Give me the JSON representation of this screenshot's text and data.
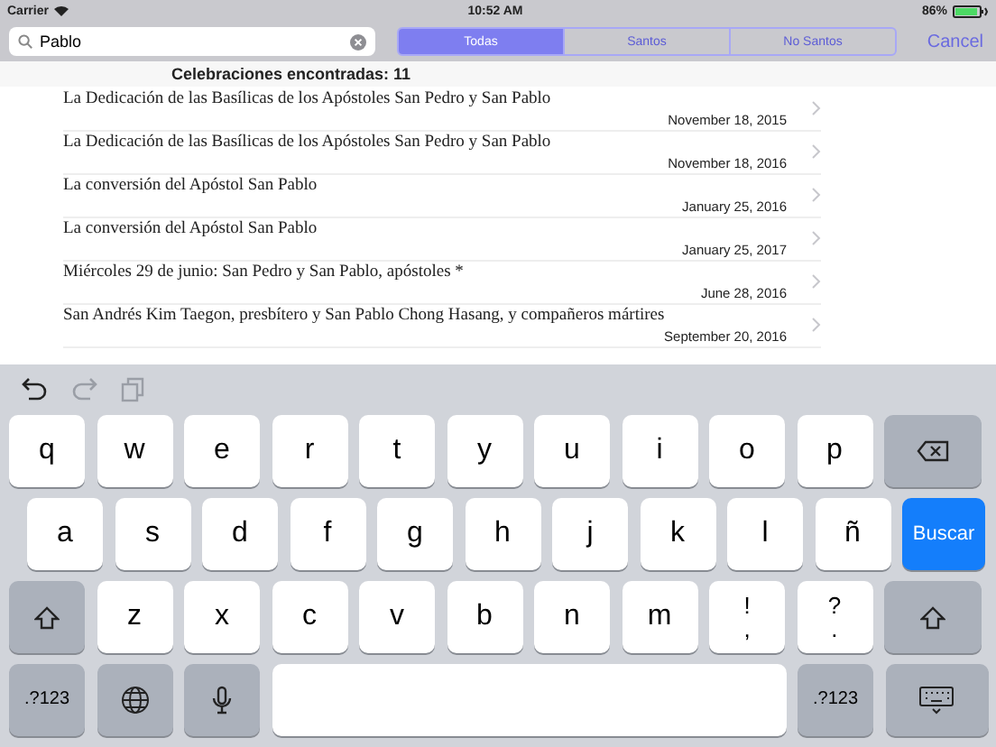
{
  "status_bar": {
    "carrier": "Carrier",
    "time": "10:52 AM",
    "battery": "86%"
  },
  "search": {
    "value": "Pablo"
  },
  "segments": [
    {
      "label": "Todas",
      "selected": true
    },
    {
      "label": "Santos",
      "selected": false
    },
    {
      "label": "No Santos",
      "selected": false
    }
  ],
  "cancel": "Cancel",
  "results_header": "Celebraciones encontradas: 11",
  "rows": [
    {
      "title": "La Dedicación de las Basílicas de los Apóstoles San Pedro y San Pablo",
      "date": "November 18, 2015"
    },
    {
      "title": "La Dedicación de las Basílicas de los Apóstoles San Pedro y San Pablo",
      "date": "November 18, 2016"
    },
    {
      "title": "La conversión del Apóstol San Pablo",
      "date": "January 25, 2016"
    },
    {
      "title": "La conversión del Apóstol San Pablo",
      "date": "January 25, 2017"
    },
    {
      "title": "Miércoles 29 de junio: San Pedro y San Pablo, apóstoles *",
      "date": "June 28, 2016"
    },
    {
      "title": "San Andrés Kim Taegon, presbítero y San Pablo Chong Hasang, y compañeros mártires",
      "date": "September 20, 2016"
    }
  ],
  "toolbar": [
    {
      "kind": "undo",
      "disabled": false
    },
    {
      "kind": "redo",
      "disabled": true
    },
    {
      "kind": "paste",
      "disabled": true
    }
  ],
  "keyboard": [
    [
      {
        "kind": "letter",
        "label": "q"
      },
      {
        "kind": "letter",
        "label": "w"
      },
      {
        "kind": "letter",
        "label": "e"
      },
      {
        "kind": "letter",
        "label": "r"
      },
      {
        "kind": "letter",
        "label": "t"
      },
      {
        "kind": "letter",
        "label": "y"
      },
      {
        "kind": "letter",
        "label": "u"
      },
      {
        "kind": "letter",
        "label": "i"
      },
      {
        "kind": "letter",
        "label": "o"
      },
      {
        "kind": "letter",
        "label": "p"
      },
      {
        "kind": "delete"
      }
    ],
    [
      {
        "kind": "letter",
        "label": "a"
      },
      {
        "kind": "letter",
        "label": "s"
      },
      {
        "kind": "letter",
        "label": "d"
      },
      {
        "kind": "letter",
        "label": "f"
      },
      {
        "kind": "letter",
        "label": "g"
      },
      {
        "kind": "letter",
        "label": "h"
      },
      {
        "kind": "letter",
        "label": "j"
      },
      {
        "kind": "letter",
        "label": "k"
      },
      {
        "kind": "letter",
        "label": "l"
      },
      {
        "kind": "letter",
        "label": "ñ"
      },
      {
        "kind": "search",
        "label": "Buscar"
      }
    ],
    [
      {
        "kind": "shift"
      },
      {
        "kind": "letter",
        "label": "z"
      },
      {
        "kind": "letter",
        "label": "x"
      },
      {
        "kind": "letter",
        "label": "c"
      },
      {
        "kind": "letter",
        "label": "v"
      },
      {
        "kind": "letter",
        "label": "b"
      },
      {
        "kind": "letter",
        "label": "n"
      },
      {
        "kind": "letter",
        "label": "m"
      },
      {
        "kind": "punct",
        "label": "!",
        "sub": ","
      },
      {
        "kind": "punct",
        "label": "?",
        "sub": "."
      },
      {
        "kind": "shift"
      }
    ],
    [
      {
        "kind": "numbers",
        "label": ".?123"
      },
      {
        "kind": "globe"
      },
      {
        "kind": "mic"
      },
      {
        "kind": "space"
      },
      {
        "kind": "numbers",
        "label": ".?123"
      },
      {
        "kind": "hide"
      }
    ]
  ]
}
